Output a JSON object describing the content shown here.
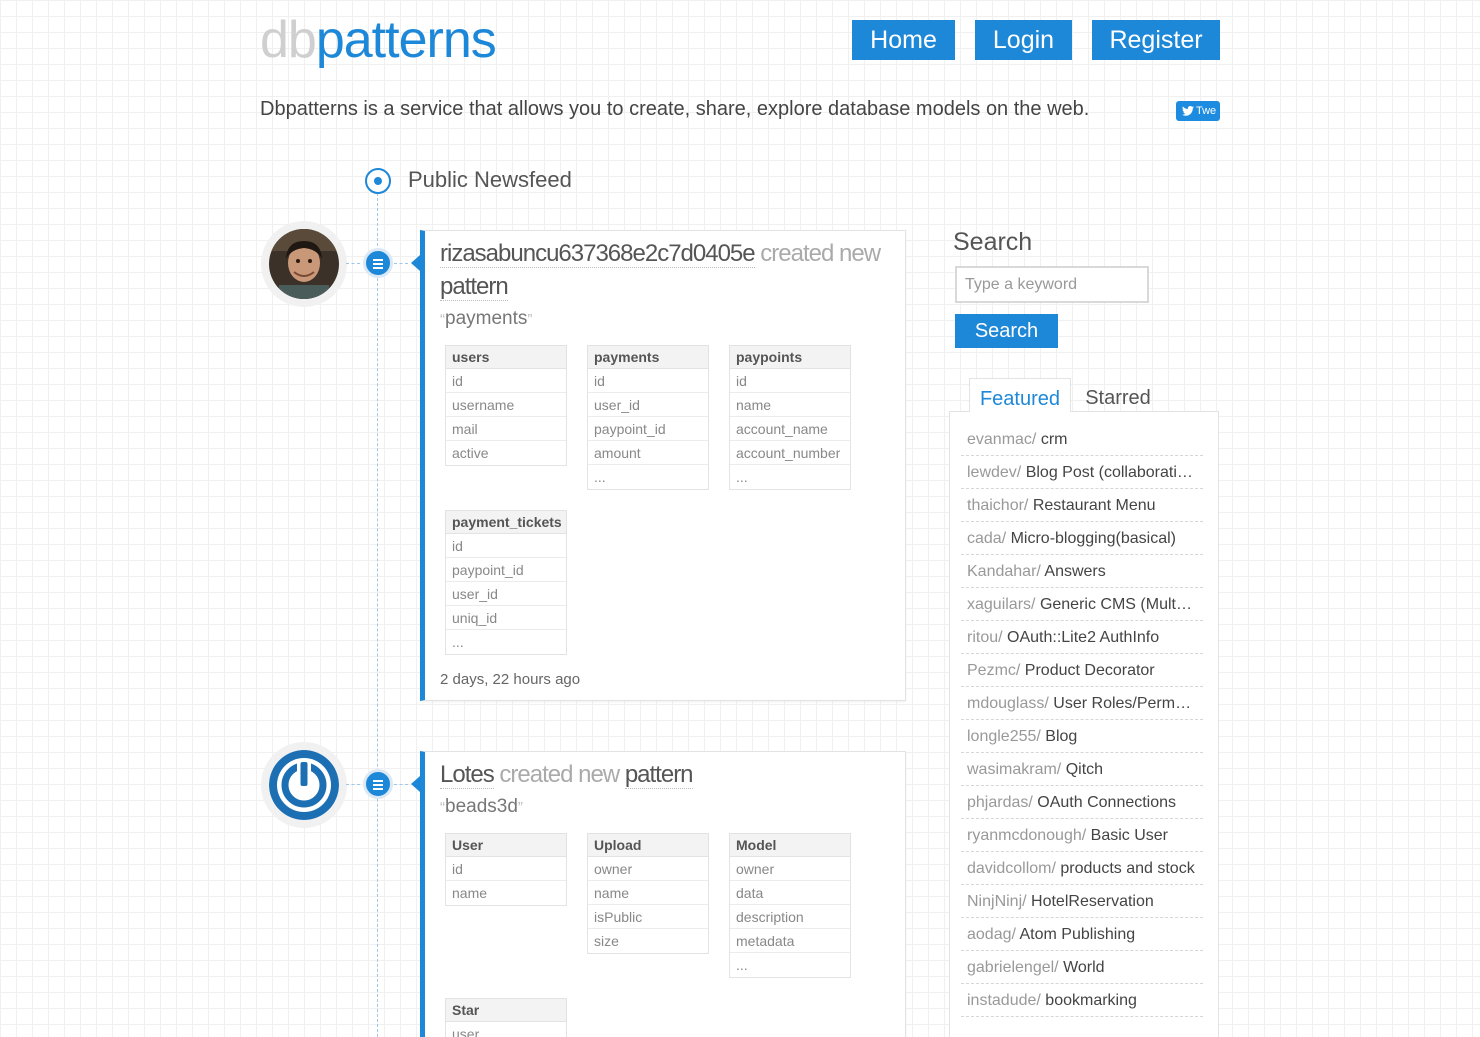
{
  "header": {
    "logo_part1": "db",
    "logo_part2": "patterns",
    "nav": {
      "home": "Home",
      "login": "Login",
      "register": "Register"
    },
    "tagline": "Dbpatterns is a service that allows you to create, share, explore database models on the web.",
    "tweet_label": "Twe"
  },
  "feed": {
    "title": "Public Newsfeed",
    "items": [
      {
        "user": "rizasabuncu637368e2c7d0405e",
        "action": "created new",
        "object": "pattern",
        "pattern_name": "payments",
        "time": "2 days, 22 hours ago",
        "tables": [
          {
            "name": "users",
            "fields": [
              "id",
              "username",
              "mail",
              "active"
            ]
          },
          {
            "name": "payments",
            "fields": [
              "id",
              "user_id",
              "paypoint_id",
              "amount",
              "..."
            ]
          },
          {
            "name": "paypoints",
            "fields": [
              "id",
              "name",
              "account_name",
              "account_number",
              "..."
            ]
          },
          {
            "name": "payment_tickets",
            "fields": [
              "id",
              "paypoint_id",
              "user_id",
              "uniq_id",
              "..."
            ]
          }
        ]
      },
      {
        "user": "Lotes",
        "action": "created new",
        "object": "pattern",
        "pattern_name": "beads3d",
        "tables": [
          {
            "name": "User",
            "fields": [
              "id",
              "name"
            ]
          },
          {
            "name": "Upload",
            "fields": [
              "owner",
              "name",
              "isPublic",
              "size"
            ]
          },
          {
            "name": "Model",
            "fields": [
              "owner",
              "data",
              "description",
              "metadata",
              "..."
            ]
          },
          {
            "name": "Star",
            "fields": [
              "user"
            ]
          }
        ]
      }
    ]
  },
  "sidebar": {
    "search_title": "Search",
    "search_placeholder": "Type a keyword",
    "search_button": "Search",
    "tabs": {
      "featured": "Featured",
      "starred": "Starred"
    },
    "patterns": [
      {
        "user": "evanmac/",
        "name": "crm"
      },
      {
        "user": "lewdev/",
        "name": "Blog Post (collaborati…"
      },
      {
        "user": "thaichor/",
        "name": "Restaurant Menu"
      },
      {
        "user": "cada/",
        "name": "Micro-blogging(basical)"
      },
      {
        "user": "Kandahar/",
        "name": "Answers"
      },
      {
        "user": "xaguilars/",
        "name": "Generic CMS (Mult…"
      },
      {
        "user": "ritou/",
        "name": "OAuth::Lite2 AuthInfo"
      },
      {
        "user": "Pezmc/",
        "name": "Product Decorator"
      },
      {
        "user": "mdouglass/",
        "name": "User Roles/Perm…"
      },
      {
        "user": "longle255/",
        "name": "Blog"
      },
      {
        "user": "wasimakram/",
        "name": "Qitch"
      },
      {
        "user": "phjardas/",
        "name": "OAuth Connections"
      },
      {
        "user": "ryanmcdonough/",
        "name": "Basic User"
      },
      {
        "user": "davidcollom/",
        "name": "products and stock"
      },
      {
        "user": "NinjNinj/",
        "name": "HotelReservation"
      },
      {
        "user": "aodag/",
        "name": "Atom Publishing"
      },
      {
        "user": "gabrielengel/",
        "name": "World"
      },
      {
        "user": "instadude/",
        "name": "bookmarking"
      }
    ]
  },
  "colors": {
    "accent": "#1e88d8",
    "logo_grey": "#cfcfcf"
  }
}
